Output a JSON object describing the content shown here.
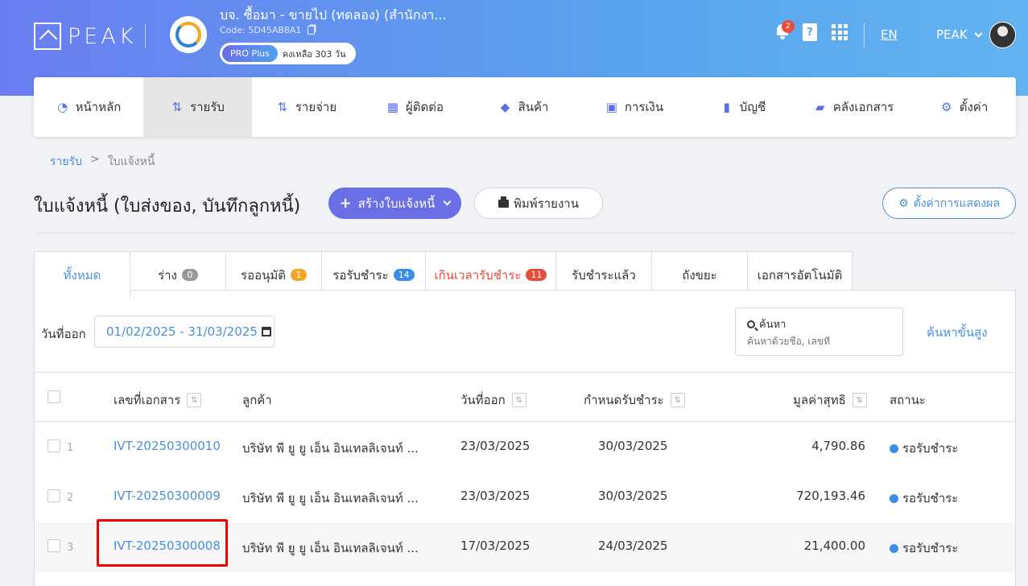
{
  "header": {
    "logo_text": "PEAK",
    "company_name": "บจ. ซื้อมา - ขายไป (ทดลอง) (สำนักงา...",
    "company_code": "Code: 5D45AB8A1",
    "plan_label": "PRO Plus",
    "plan_remaining": "คงเหลือ 303 วัน",
    "notification_count": "2",
    "help_icon_text": "?",
    "language": "EN",
    "user_name": "PEAK"
  },
  "nav": {
    "items": [
      {
        "label": "หน้าหลัก",
        "icon": "dashboard-icon"
      },
      {
        "label": "รายรับ",
        "icon": "income-icon"
      },
      {
        "label": "รายจ่าย",
        "icon": "expense-icon"
      },
      {
        "label": "ผู้ติดต่อ",
        "icon": "contacts-icon"
      },
      {
        "label": "สินค้า",
        "icon": "product-box-icon"
      },
      {
        "label": "การเงิน",
        "icon": "money-icon"
      },
      {
        "label": "บัญชี",
        "icon": "account-book-icon"
      },
      {
        "label": "คลังเอกสาร",
        "icon": "folder-icon"
      },
      {
        "label": "ตั้งค่า",
        "icon": "gear-icon"
      }
    ],
    "active": "รายรับ"
  },
  "breadcrumb": {
    "parent": "รายรับ",
    "separator": ">",
    "current": "ใบแจ้งหนี้"
  },
  "page": {
    "title": "ใบแจ้งหนี้ (ใบส่งของ, บันทึกลูกหนี้)",
    "create_button": "สร้างใบแจ้งหนี้",
    "print_button": "พิมพ์รายงาน",
    "display_settings_button": "ตั้งค่าการแสดงผล"
  },
  "tabs": [
    {
      "label": "ทั้งหมด",
      "count": null
    },
    {
      "label": "ร่าง",
      "count": "0"
    },
    {
      "label": "รออนุมัติ",
      "count": "1"
    },
    {
      "label": "รอรับชำระ",
      "count": "14"
    },
    {
      "label": "เกินเวลารับชำระ",
      "count": "11"
    },
    {
      "label": "รับชำระแล้ว",
      "count": null
    },
    {
      "label": "ถังขยะ",
      "count": null
    },
    {
      "label": "เอกสารอัตโนมัติ",
      "count": null
    }
  ],
  "filter": {
    "date_label": "วันที่ออก",
    "date_range": "01/02/2025 - 31/03/2025",
    "search_label": "ค้นหา",
    "search_placeholder": "ค้นหาด้วยชื่อ, เลขที่",
    "advanced_search": "ค้นหาขั้นสูง"
  },
  "table": {
    "columns": [
      "เลขที่เอกสาร",
      "ลูกค้า",
      "วันที่ออก",
      "กำหนดรับชำระ",
      "มูลค่าสุทธิ",
      "สถานะ"
    ],
    "sort_glyph": "⇅",
    "rows": [
      {
        "num": "1",
        "doc_no": "IVT-20250300010",
        "customer": "บริษัท พี ยู ยู เอ็น อินเทลลิเจนท์ ...",
        "issue_date": "23/03/2025",
        "due_date": "30/03/2025",
        "amount": "4,790.86",
        "status": "รอรับชำระ"
      },
      {
        "num": "2",
        "doc_no": "IVT-20250300009",
        "customer": "บริษัท พี ยู ยู เอ็น อินเทลลิเจนท์ ...",
        "issue_date": "23/03/2025",
        "due_date": "30/03/2025",
        "amount": "720,193.46",
        "status": "รอรับชำระ"
      },
      {
        "num": "3",
        "doc_no": "IVT-20250300008",
        "customer": "บริษัท พี ยู ยู เอ็น อินเทลลิเจนท์ ...",
        "issue_date": "17/03/2025",
        "due_date": "24/03/2025",
        "amount": "21,400.00",
        "status": "รอรับชำระ"
      }
    ]
  },
  "colors": {
    "accent": "#6b6fe6",
    "link": "#4a90d9",
    "status_dot": "#3a8ee6",
    "overdue": "#e74c3c",
    "highlight_box": "#ee0000"
  }
}
